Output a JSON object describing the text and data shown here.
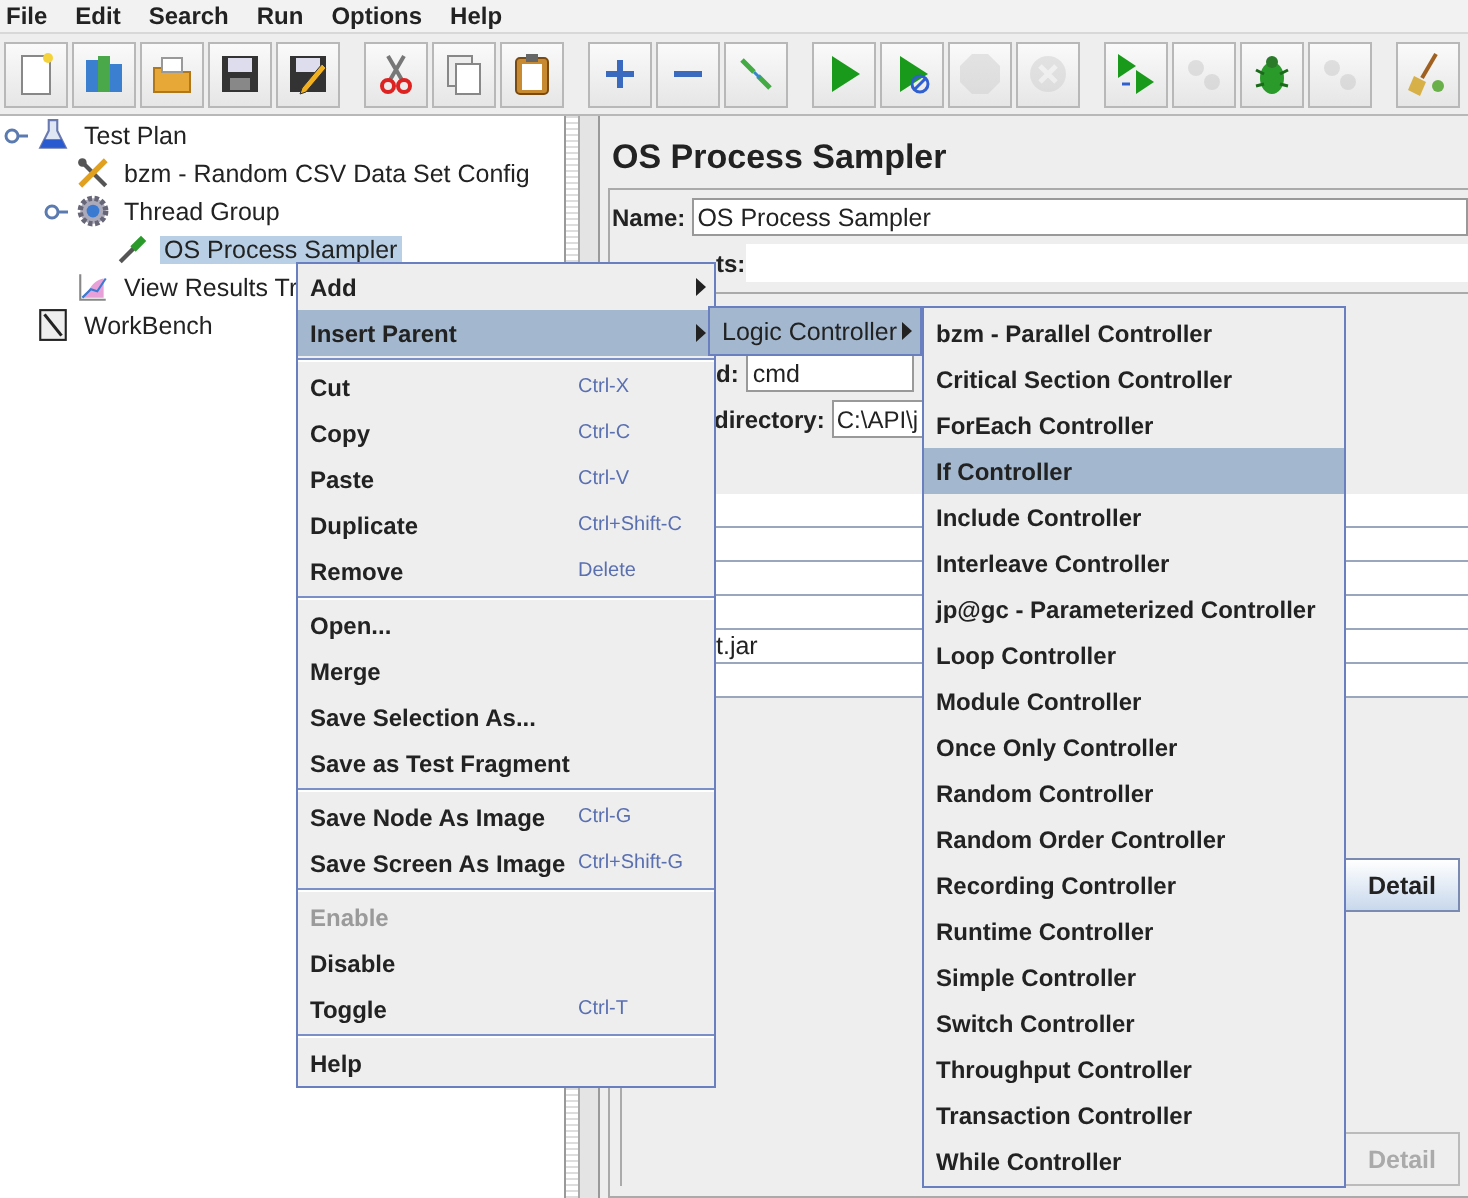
{
  "menu_bar": [
    "File",
    "Edit",
    "Search",
    "Run",
    "Options",
    "Help"
  ],
  "toolbar": [
    [
      {
        "kind": "new",
        "disabled": false
      },
      {
        "kind": "templates",
        "disabled": false
      },
      {
        "kind": "open",
        "disabled": false
      },
      {
        "kind": "save",
        "disabled": false
      },
      {
        "kind": "saveas",
        "disabled": false
      }
    ],
    [
      {
        "kind": "cut",
        "disabled": false
      },
      {
        "kind": "copy",
        "disabled": false
      },
      {
        "kind": "paste",
        "disabled": false
      }
    ],
    [
      {
        "kind": "expand",
        "disabled": false
      },
      {
        "kind": "collapse",
        "disabled": false
      },
      {
        "kind": "toggle",
        "disabled": false
      }
    ],
    [
      {
        "kind": "start",
        "disabled": false
      },
      {
        "kind": "startnopause",
        "disabled": false
      },
      {
        "kind": "stop",
        "disabled": true
      },
      {
        "kind": "shutdown",
        "disabled": true
      }
    ],
    [
      {
        "kind": "remotestart",
        "disabled": false
      },
      {
        "kind": "remotestop",
        "disabled": true
      },
      {
        "kind": "bug",
        "disabled": false
      },
      {
        "kind": "remoteexit",
        "disabled": true
      }
    ],
    [
      {
        "kind": "clear",
        "disabled": false
      }
    ]
  ],
  "tree": [
    {
      "label": "Test Plan",
      "kind": "plan",
      "expanded": true,
      "selected": false,
      "children": [
        {
          "label": "bzm - Random CSV Data Set Config",
          "kind": "config",
          "selected": false
        },
        {
          "label": "Thread Group",
          "kind": "threads",
          "expanded": true,
          "selected": false,
          "children": [
            {
              "label": "OS Process Sampler",
              "kind": "sampler",
              "selected": true
            }
          ]
        },
        {
          "label": "View Results Tr",
          "kind": "listener",
          "selected": false
        }
      ]
    },
    {
      "label": "WorkBench",
      "kind": "workbench",
      "selected": false
    }
  ],
  "editor": {
    "title": "OS Process Sampler",
    "name_label": "Name:",
    "name_value": "OS Process Sampler",
    "comments_label": "ts:",
    "command_label": "d:",
    "command_value": "cmd",
    "directory_label": "directory:",
    "directory_value": "C:\\API\\j",
    "param_value": "t.jar",
    "buttons": [
      {
        "label": "Detail",
        "disabled": false
      },
      {
        "label": "Detail",
        "disabled": true
      }
    ]
  },
  "context_menu": {
    "groups": [
      [
        {
          "label": "Add",
          "kind": "submenu",
          "selected": false,
          "disabled": false
        },
        {
          "label": "Insert Parent",
          "kind": "submenu",
          "selected": true,
          "disabled": false
        }
      ],
      [
        {
          "label": "Cut",
          "shortcut": "Ctrl-X",
          "kind": "action",
          "selected": false,
          "disabled": false
        },
        {
          "label": "Copy",
          "shortcut": "Ctrl-C",
          "kind": "action",
          "selected": false,
          "disabled": false
        },
        {
          "label": "Paste",
          "shortcut": "Ctrl-V",
          "kind": "action",
          "selected": false,
          "disabled": false
        },
        {
          "label": "Duplicate",
          "shortcut": "Ctrl+Shift-C",
          "kind": "action",
          "selected": false,
          "disabled": false
        },
        {
          "label": "Remove",
          "shortcut": "Delete",
          "kind": "action",
          "selected": false,
          "disabled": false
        }
      ],
      [
        {
          "label": "Open...",
          "kind": "action",
          "selected": false,
          "disabled": false
        },
        {
          "label": "Merge",
          "kind": "action",
          "selected": false,
          "disabled": false
        },
        {
          "label": "Save Selection As...",
          "kind": "action",
          "selected": false,
          "disabled": false
        },
        {
          "label": "Save as Test Fragment",
          "kind": "action",
          "selected": false,
          "disabled": false
        }
      ],
      [
        {
          "label": "Save Node As Image",
          "shortcut": "Ctrl-G",
          "kind": "action",
          "selected": false,
          "disabled": false
        },
        {
          "label": "Save Screen As Image",
          "shortcut": "Ctrl+Shift-G",
          "kind": "action",
          "selected": false,
          "disabled": false
        }
      ],
      [
        {
          "label": "Enable",
          "kind": "action",
          "selected": false,
          "disabled": true
        },
        {
          "label": "Disable",
          "kind": "action",
          "selected": false,
          "disabled": false
        },
        {
          "label": "Toggle",
          "shortcut": "Ctrl-T",
          "kind": "action",
          "selected": false,
          "disabled": false
        }
      ],
      [
        {
          "label": "Help",
          "kind": "action",
          "selected": false,
          "disabled": false
        }
      ]
    ]
  },
  "parent_submenu": [
    {
      "label": "Logic Controller",
      "kind": "submenu",
      "selected": true
    }
  ],
  "controller_submenu": [
    {
      "label": "bzm - Parallel Controller",
      "selected": false
    },
    {
      "label": "Critical Section Controller",
      "selected": false
    },
    {
      "label": "ForEach Controller",
      "selected": false
    },
    {
      "label": "If Controller",
      "selected": true
    },
    {
      "label": "Include Controller",
      "selected": false
    },
    {
      "label": "Interleave Controller",
      "selected": false
    },
    {
      "label": "jp@gc - Parameterized Controller",
      "selected": false
    },
    {
      "label": "Loop Controller",
      "selected": false
    },
    {
      "label": "Module Controller",
      "selected": false
    },
    {
      "label": "Once Only Controller",
      "selected": false
    },
    {
      "label": "Random Controller",
      "selected": false
    },
    {
      "label": "Random Order Controller",
      "selected": false
    },
    {
      "label": "Recording Controller",
      "selected": false
    },
    {
      "label": "Runtime Controller",
      "selected": false
    },
    {
      "label": "Simple Controller",
      "selected": false
    },
    {
      "label": "Switch Controller",
      "selected": false
    },
    {
      "label": "Throughput Controller",
      "selected": false
    },
    {
      "label": "Transaction Controller",
      "selected": false
    },
    {
      "label": "While Controller",
      "selected": false
    }
  ]
}
